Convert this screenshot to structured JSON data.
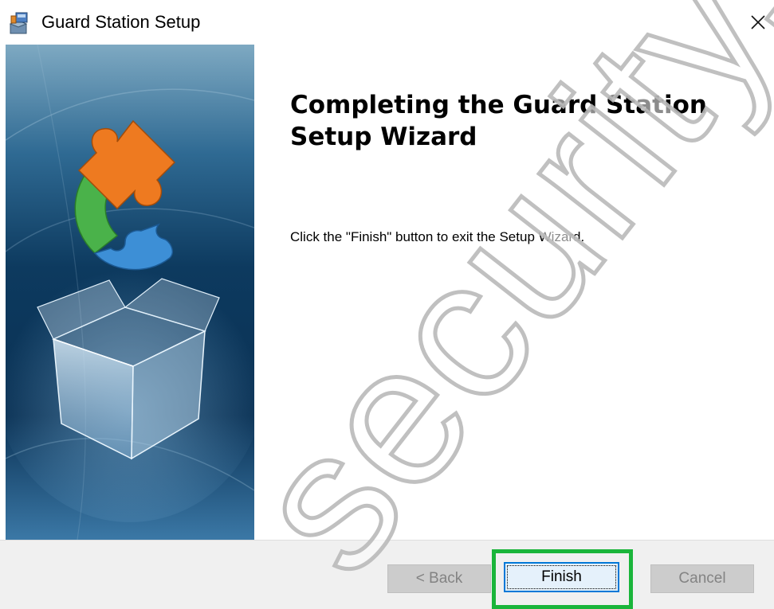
{
  "window": {
    "title": "Guard Station Setup",
    "close_glyph": "✕",
    "app_icon": "installer-icon"
  },
  "side_panel": {
    "image": "puzzle-box-banner"
  },
  "content": {
    "heading": "Completing the Guard Station Setup Wizard",
    "instruction": "Click the \"Finish\" button to exit the Setup Wizard."
  },
  "buttons": {
    "back": {
      "label": "< Back",
      "enabled": false
    },
    "finish": {
      "label": "Finish",
      "enabled": true,
      "focused": true
    },
    "cancel": {
      "label": "Cancel",
      "enabled": false
    }
  },
  "overlay": {
    "watermark_text": "security.com",
    "highlight_color": "#1ab53a"
  },
  "colors": {
    "focus_border": "#0078d7",
    "disabled_button_bg": "#cccccc",
    "footer_bg": "#f0f0f0"
  }
}
